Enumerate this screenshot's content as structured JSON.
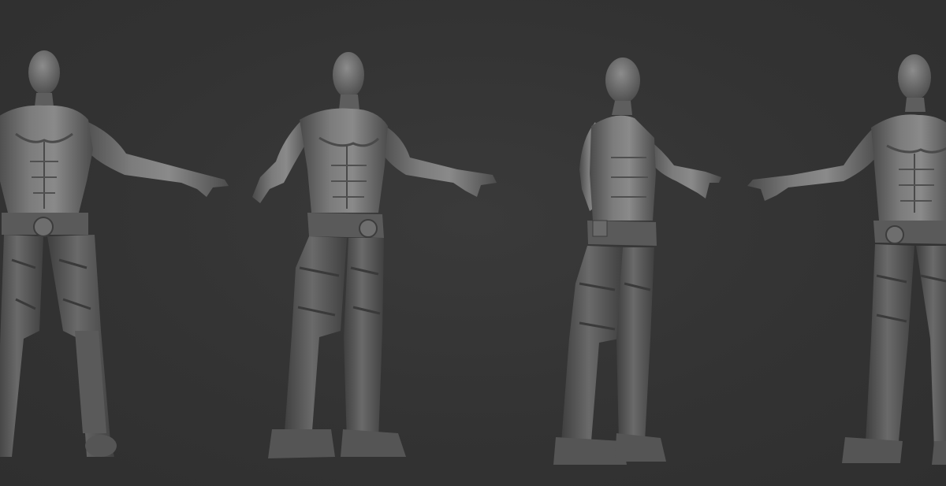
{
  "scene": {
    "background_color": "#333333",
    "model_color": "#6b6b6b",
    "model_highlight": "#8a8a8a",
    "model_shadow": "#3d3d3d",
    "views": [
      {
        "view": "front"
      },
      {
        "view": "three-quarter-left"
      },
      {
        "view": "side"
      },
      {
        "view": "three-quarter-right"
      }
    ]
  }
}
